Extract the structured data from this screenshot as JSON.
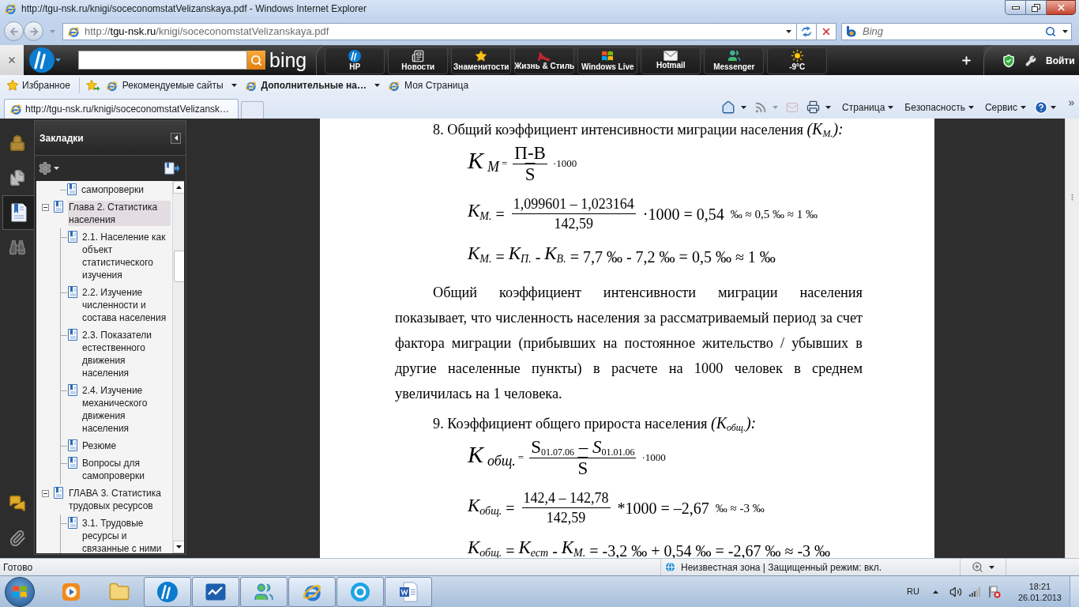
{
  "window": {
    "title": "http://tgu-nsk.ru/knigi/soceconomstatVelizanskaya.pdf - Windows Internet Explorer"
  },
  "address_bar": {
    "url": "http://**tgu-nsk.ru**/knigi/soceconomstatVelizanskaya.pdf"
  },
  "search_box": {
    "placeholder": "Bing"
  },
  "hp_toolbar": {
    "search_provider": "bing",
    "tiles": [
      {
        "kind": "hp",
        "label": "HP"
      },
      {
        "kind": "news",
        "label": "Новости"
      },
      {
        "kind": "celebrities",
        "label": "Знаменитости"
      },
      {
        "kind": "style",
        "label": "Жизнь & Стиль"
      },
      {
        "kind": "windows_live",
        "label": "Windows Live"
      },
      {
        "kind": "mail",
        "label": "Hotmail"
      },
      {
        "kind": "messenger",
        "label": "Messenger"
      },
      {
        "kind": "weather",
        "label": "-9°C"
      }
    ],
    "sign_in": "Войти"
  },
  "favorites_bar": {
    "favorites": "Избранное",
    "links": [
      {
        "label": "Рекомендуемые сайты",
        "bold": false,
        "dropdown": true
      },
      {
        "label": "Дополнительные на…",
        "bold": true,
        "dropdown": true
      },
      {
        "label": "Моя Страница",
        "bold": false,
        "dropdown": false
      }
    ]
  },
  "tabs": [
    {
      "label": "http://tgu-nsk.ru/knigi/soceconomstatVelizansk…",
      "selected": true
    }
  ],
  "command_bar": {
    "commands": [
      {
        "kind": "home",
        "disabled": false,
        "dropdown": true
      },
      {
        "kind": "feeds",
        "disabled": true,
        "dropdown": true
      },
      {
        "kind": "read_mail",
        "disabled": true,
        "dropdown": false
      },
      {
        "kind": "print",
        "disabled": false,
        "dropdown": true
      }
    ],
    "menus": [
      "Страница",
      "Безопасность",
      "Сервис"
    ]
  },
  "reader": {
    "tool_buttons": [
      {
        "kind": "lock",
        "selected": false
      },
      {
        "kind": "pages",
        "selected": false
      },
      {
        "kind": "bookmarks",
        "selected": true
      },
      {
        "kind": "search",
        "selected": false
      }
    ],
    "bottom_buttons": [
      {
        "kind": "comments"
      },
      {
        "kind": "attachments"
      }
    ],
    "panel_title": "Закладки",
    "bookmarks": [
      {
        "children": [
          {
            "label": "самопроверки",
            "selected": false
          }
        ]
      },
      {
        "label": "Глава 2. Статистика населения",
        "expanded": true,
        "selected": true,
        "children": [
          {
            "label": "2.1. Население как объект статистического изучения",
            "selected": false
          },
          {
            "label": "2.2. Изучение численности и состава населения",
            "selected": false
          },
          {
            "label": "2.3. Показатели естественного движения населения",
            "selected": false
          },
          {
            "label": "2.4. Изучение механического движения населения",
            "selected": false
          },
          {
            "label": "Резюме",
            "selected": false
          },
          {
            "label": "Вопросы для самопроверки",
            "selected": false
          }
        ]
      },
      {
        "label": "ГЛАВА 3. Статистика трудовых ресурсов",
        "expanded": true,
        "selected": false,
        "children": [
          {
            "label": "3.1. Трудовые ресурсы и связанные с ними",
            "selected": false
          }
        ]
      }
    ]
  },
  "document": {
    "blocks": [
      {
        "kind": "heading",
        "text": "8. Общий коэффициент интенсивности миграции населения *(К*$_{М.}$*):*"
      },
      {
        "kind": "definition_formula",
        "parts": [
          {
            "kind": "symbol",
            "text": "К",
            "sub": "М"
          },
          {
            "kind": "small_text",
            "text": "="
          },
          {
            "kind": "fraction",
            "numerator": "П-В",
            "denominator": "S",
            "overlined": true
          },
          {
            "kind": "small_text",
            "text": "·1000"
          }
        ]
      },
      {
        "kind": "calculation_formula",
        "parts": [
          {
            "kind": "symbol",
            "text": "К",
            "sub": "М."
          },
          {
            "kind": "text",
            "text": "="
          },
          {
            "kind": "fraction",
            "numerator": "1,099601 – 1,023164",
            "denominator": "142,59",
            "overlined": false
          },
          {
            "kind": "text",
            "text": "·1000 = 0,54"
          },
          {
            "kind": "small_text",
            "text": "‰ ≈ 0,5 ‰ ≈ 1 ‰"
          }
        ]
      },
      {
        "kind": "calculation_formula",
        "parts": [
          {
            "kind": "symbol",
            "text": "К",
            "sub": "М."
          },
          {
            "kind": "text",
            "text": "="
          },
          {
            "kind": "symbol",
            "text": "К",
            "sub": "П."
          },
          {
            "kind": "text",
            "text": "-"
          },
          {
            "kind": "symbol",
            "text": "К",
            "sub": "В."
          },
          {
            "kind": "text",
            "text": "= 7,7 ‰ - 7,2 ‰ = 0,5 ‰ ≈ 1 ‰"
          }
        ]
      },
      {
        "kind": "paragraph",
        "text": "Общий коэффициент интенсивности миграции населения показывает, что численность населения за рассматриваемый период за счет фактора миграции (прибывших на постоянное жительство / убывших в другие населенные пункты) в расчете на 1000 человек в среднем увеличилась на 1 человека."
      },
      {
        "kind": "heading",
        "text": "9. Коэффициент общего прироста населения *(К*$_{общ.}$*):*"
      },
      {
        "kind": "definition_formula",
        "parts": [
          {
            "kind": "symbol",
            "text": "К",
            "sub": "общ."
          },
          {
            "kind": "small_text",
            "text": "="
          },
          {
            "kind": "fraction",
            "numerator": "S$_{01.07.06}$ – *S*$_{01.01.06}$",
            "denominator": "S",
            "overlined": true
          },
          {
            "kind": "small_text",
            "text": "·1000"
          }
        ]
      },
      {
        "kind": "calculation_formula",
        "parts": [
          {
            "kind": "symbol",
            "text": "К",
            "sub": "общ."
          },
          {
            "kind": "text",
            "text": "="
          },
          {
            "kind": "fraction",
            "numerator": "142,4 – 142,78",
            "denominator": "142,59",
            "overlined": false
          },
          {
            "kind": "text",
            "text": "*1000 = –2,67"
          },
          {
            "kind": "small_text",
            "text": "‰ ≈ -3 ‰"
          }
        ]
      },
      {
        "kind": "calculation_formula",
        "parts": [
          {
            "kind": "symbol",
            "text": "К",
            "sub": "общ."
          },
          {
            "kind": "text",
            "text": "="
          },
          {
            "kind": "symbol",
            "text": "К",
            "sub": "ест"
          },
          {
            "kind": "text",
            "text": "-"
          },
          {
            "kind": "symbol",
            "text": "К",
            "sub": "М."
          },
          {
            "kind": "text",
            "text": "= -3,2 ‰ + 0,54 ‰ = -2,67 ‰ ≈ -3 ‰"
          }
        ]
      }
    ]
  },
  "status_bar": {
    "status": "Готово",
    "zone": "Неизвестная зона | Защищенный режим: вкл."
  },
  "taskbar": {
    "apps": [
      {
        "kind": "media_player",
        "active": false
      },
      {
        "kind": "libraries",
        "active": false
      },
      {
        "kind": "hp",
        "active": true
      },
      {
        "kind": "wave",
        "active": true
      },
      {
        "kind": "messenger",
        "active": true
      },
      {
        "kind": "browser",
        "active": true
      },
      {
        "kind": "skype",
        "active": true
      },
      {
        "kind": "word",
        "active": true
      }
    ],
    "language": "RU",
    "time": "18:21",
    "date": "26.01.2013"
  }
}
